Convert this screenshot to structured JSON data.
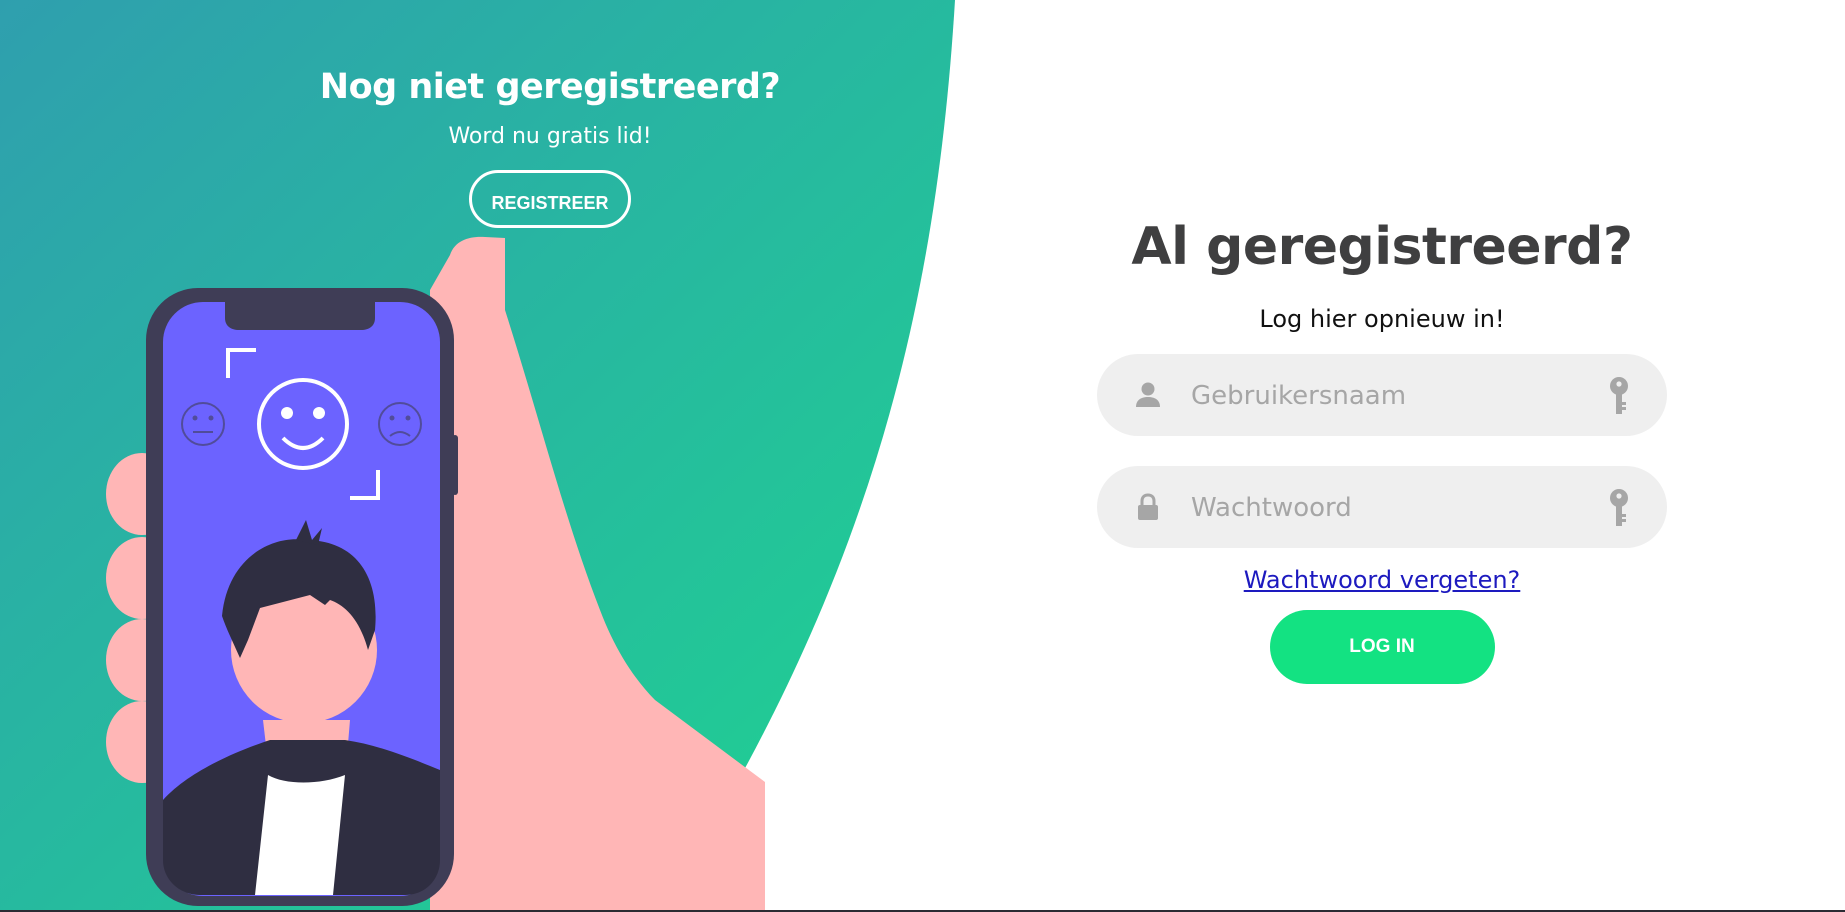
{
  "signup": {
    "title": "Nog niet geregistreerd?",
    "subtitle": "Word nu gratis lid!",
    "button_label": "REGISTREER"
  },
  "login": {
    "title": "Al geregistreerd?",
    "subtitle": "Log hier opnieuw in!",
    "username": {
      "placeholder": "Gebruikersnaam",
      "value": "",
      "lead_icon": "user-icon",
      "trail_icon": "key-icon"
    },
    "password": {
      "placeholder": "Wachtwoord",
      "value": "",
      "lead_icon": "lock-icon",
      "trail_icon": "key-icon"
    },
    "forgot_link": "Wachtwoord vergeten?",
    "button_label": "LOG IN"
  },
  "colors": {
    "gradient_start": "#2f9fae",
    "gradient_end": "#1ed490",
    "phone_screen": "#6c63ff",
    "hand_skin": "#ffb6b6",
    "login_button": "#13e282",
    "field_bg": "#efefef",
    "title_dark": "#3f3f40"
  }
}
